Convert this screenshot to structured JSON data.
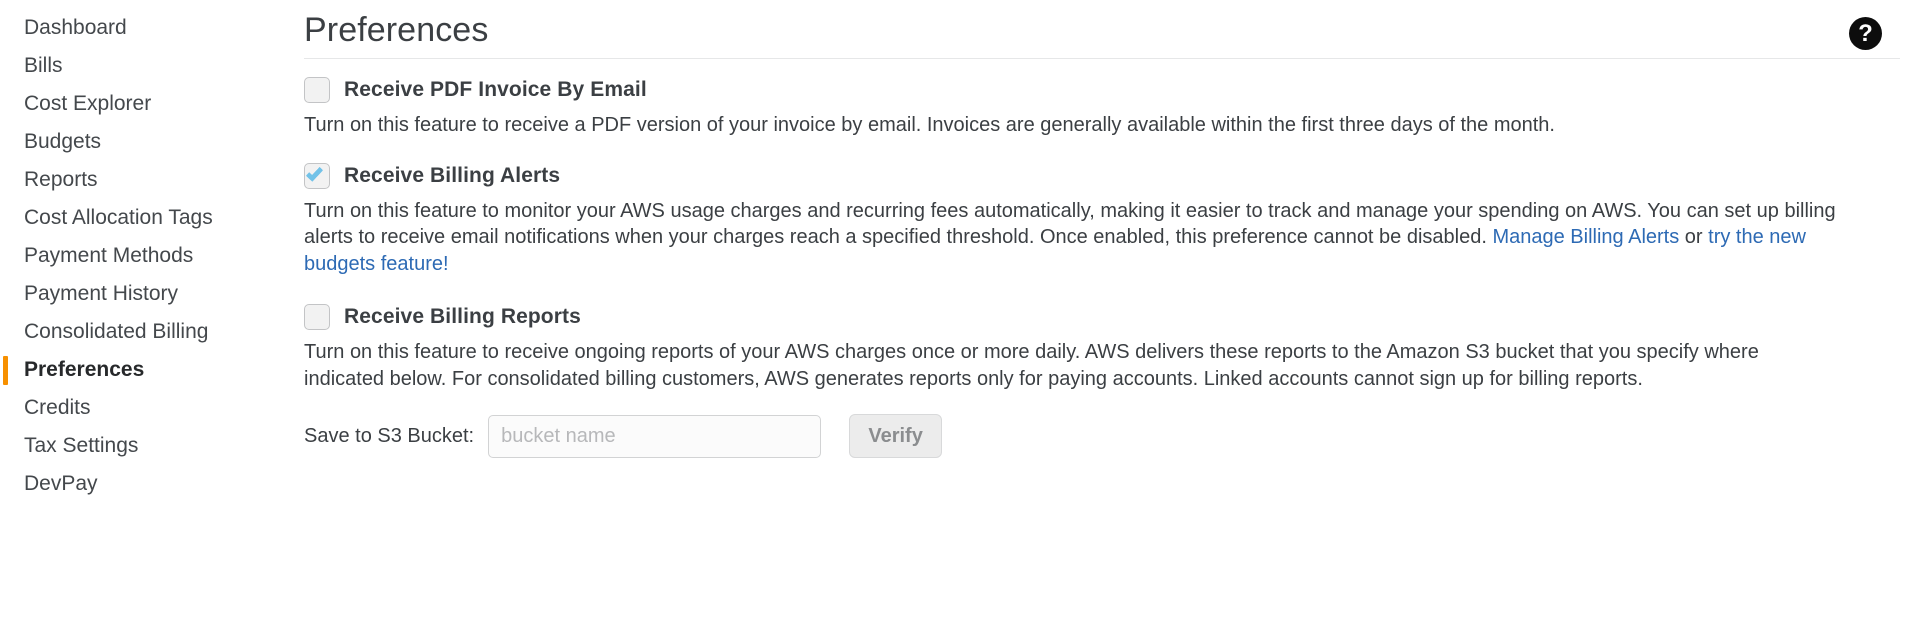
{
  "sidebar": {
    "items": [
      {
        "label": "Dashboard",
        "active": false
      },
      {
        "label": "Bills",
        "active": false
      },
      {
        "label": "Cost Explorer",
        "active": false
      },
      {
        "label": "Budgets",
        "active": false
      },
      {
        "label": "Reports",
        "active": false
      },
      {
        "label": "Cost Allocation Tags",
        "active": false
      },
      {
        "label": "Payment Methods",
        "active": false
      },
      {
        "label": "Payment History",
        "active": false
      },
      {
        "label": "Consolidated Billing",
        "active": false
      },
      {
        "label": "Preferences",
        "active": true
      },
      {
        "label": "Credits",
        "active": false
      },
      {
        "label": "Tax Settings",
        "active": false
      },
      {
        "label": "DevPay",
        "active": false
      }
    ]
  },
  "header": {
    "title": "Preferences",
    "help_icon": "help-question-icon",
    "help_glyph": "?"
  },
  "preferences": {
    "pdf_invoice": {
      "label": "Receive PDF Invoice By Email",
      "checked": false,
      "description": "Turn on this feature to receive a PDF version of your invoice by email. Invoices are generally available within the first three days of the month."
    },
    "billing_alerts": {
      "label": "Receive Billing Alerts",
      "checked": true,
      "desc_part1": "Turn on this feature to monitor your AWS usage charges and recurring fees automatically, making it easier to track and manage your spending on AWS. You can set up billing alerts to receive email notifications when your charges reach a specified threshold. Once enabled, this preference cannot be disabled. ",
      "link1": "Manage Billing Alerts",
      "desc_mid": " or ",
      "link2": "try the new budgets feature!"
    },
    "billing_reports": {
      "label": "Receive Billing Reports",
      "checked": false,
      "description": "Turn on this feature to receive ongoing reports of your AWS charges once or more daily. AWS delivers these reports to the Amazon S3 bucket that you specify where indicated below. For consolidated billing customers, AWS generates reports only for paying accounts. Linked accounts cannot sign up for billing reports.",
      "bucket_label": "Save to S3 Bucket:",
      "bucket_value": "",
      "bucket_placeholder": "bucket name",
      "verify_label": "Verify"
    }
  },
  "colors": {
    "accent_orange": "#f79000",
    "link_blue": "#2d6ab4",
    "checkbox_tick": "#72c2e8",
    "text": "#3b3f43"
  }
}
